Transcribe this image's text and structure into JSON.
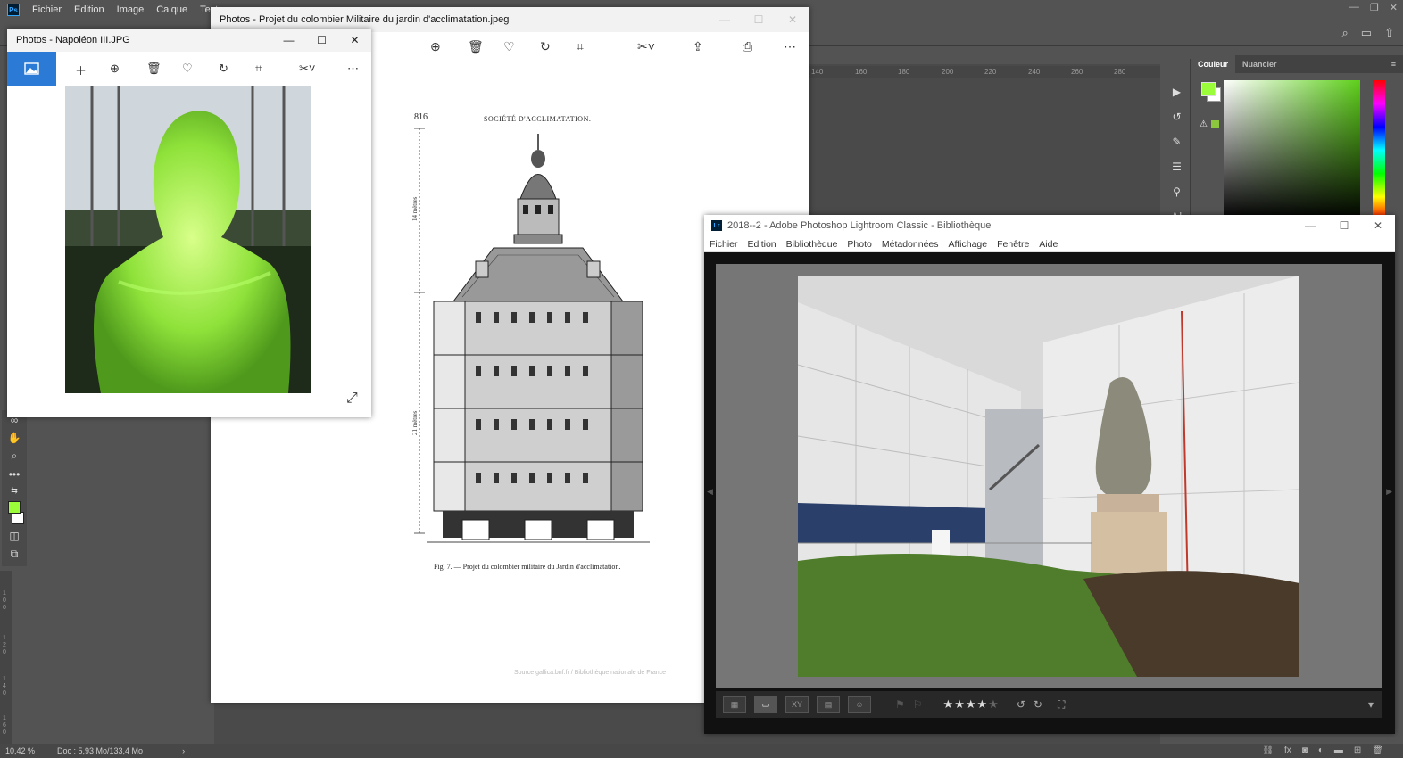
{
  "photoshop": {
    "menu": [
      "Fichier",
      "Edition",
      "Image",
      "Calque",
      "Texte"
    ],
    "logo": "Ps",
    "ruler_ticks": [
      "140",
      "160",
      "180",
      "200",
      "220",
      "240",
      "260",
      "280"
    ],
    "ruler_left_ticks": [
      "1",
      "0",
      "0",
      "1",
      "2",
      "0",
      "1",
      "4",
      "0",
      "1",
      "6",
      "0"
    ],
    "color_tabs": [
      "Couleur",
      "Nuancier"
    ],
    "foreground_color": "#9bfc3a",
    "background_color": "#ffffff",
    "status": {
      "zoom": "10,42 %",
      "doc": "Doc : 5,93 Mo/133,4 Mo",
      "arrow": "›"
    }
  },
  "photos_big": {
    "title": "Photos - Projet du colombier Militaire du jardin d'acclimatation.jpeg",
    "page_number": "816",
    "page_header": "SOCIÉTÉ D'ACCLIMATATION.",
    "caption": "Fig. 7. — Projet du colombier militaire du Jardin d'acclimatation.",
    "dim_top": "14 mètres",
    "dim_bottom": "21 mètres",
    "source": "Source gallica.bnf.fr / Bibliothèque nationale de France"
  },
  "photos_small": {
    "title": "Photos - Napoléon III.JPG"
  },
  "lightroom": {
    "logo": "Lr",
    "title": "2018--2 - Adobe Photoshop Lightroom Classic - Bibliothèque",
    "menu": [
      "Fichier",
      "Edition",
      "Bibliothèque",
      "Photo",
      "Métadonnées",
      "Affichage",
      "Fenêtre",
      "Aide"
    ],
    "rating": 4,
    "rating_max": 5,
    "stars_text": "★★★★★"
  }
}
